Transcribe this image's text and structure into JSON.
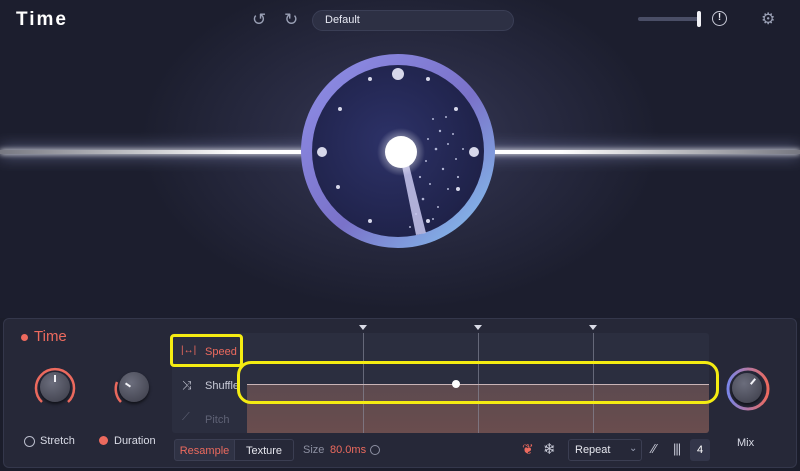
{
  "header": {
    "title": "Time",
    "preset_name": "Default",
    "volume_level": 0.95,
    "icons": {
      "undo": "undo-icon",
      "redo": "redo-icon",
      "warning": "warning-icon",
      "settings": "gear-icon"
    }
  },
  "module": {
    "title": "Time",
    "accent_color": "#ec6a5e",
    "knobs": [
      {
        "label": "Stretch",
        "icon": "clock-icon"
      },
      {
        "label": "Duration",
        "icon": "timer-icon"
      }
    ],
    "lanes": [
      {
        "label": "Speed",
        "icon": "speed-arrows-icon",
        "active": true
      },
      {
        "label": "Shuffle",
        "icon": "shuffle-icon",
        "active": false
      },
      {
        "label": "Pitch",
        "icon": "pitch-icon",
        "active": false
      }
    ],
    "mode_tabs": [
      "Resample",
      "Texture"
    ],
    "active_tab": "Resample",
    "size_label": "Size",
    "size_value": "80.0ms",
    "repeat": {
      "selected": "Repeat"
    },
    "count": "4",
    "mix_label": "Mix"
  },
  "colors": {
    "accent": "#ec6a5e",
    "highlight": "#f4ec12",
    "panel": "#262838"
  }
}
